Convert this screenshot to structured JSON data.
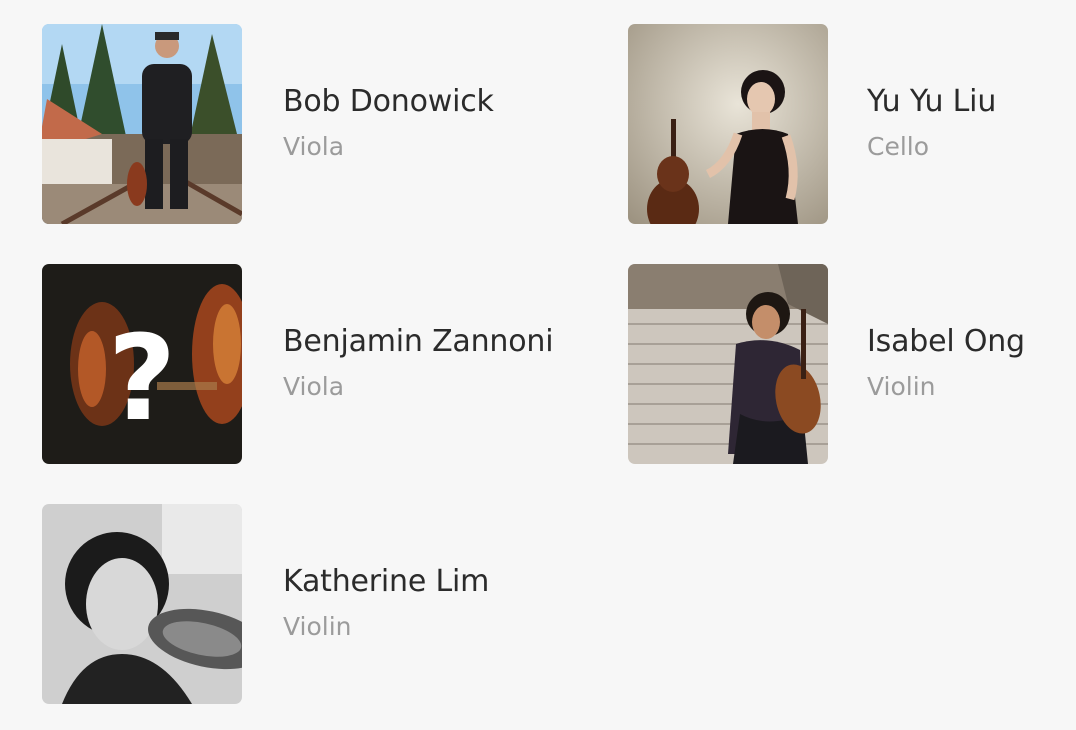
{
  "musicians": [
    {
      "name": "Bob Donowick",
      "instrument": "Viola"
    },
    {
      "name": "Yu Yu Liu",
      "instrument": "Cello"
    },
    {
      "name": "Benjamin Zannoni",
      "instrument": "Viola"
    },
    {
      "name": "Isabel Ong",
      "instrument": "Violin"
    },
    {
      "name": "Katherine Lim",
      "instrument": "Violin"
    }
  ],
  "placeholder_mark": "?"
}
